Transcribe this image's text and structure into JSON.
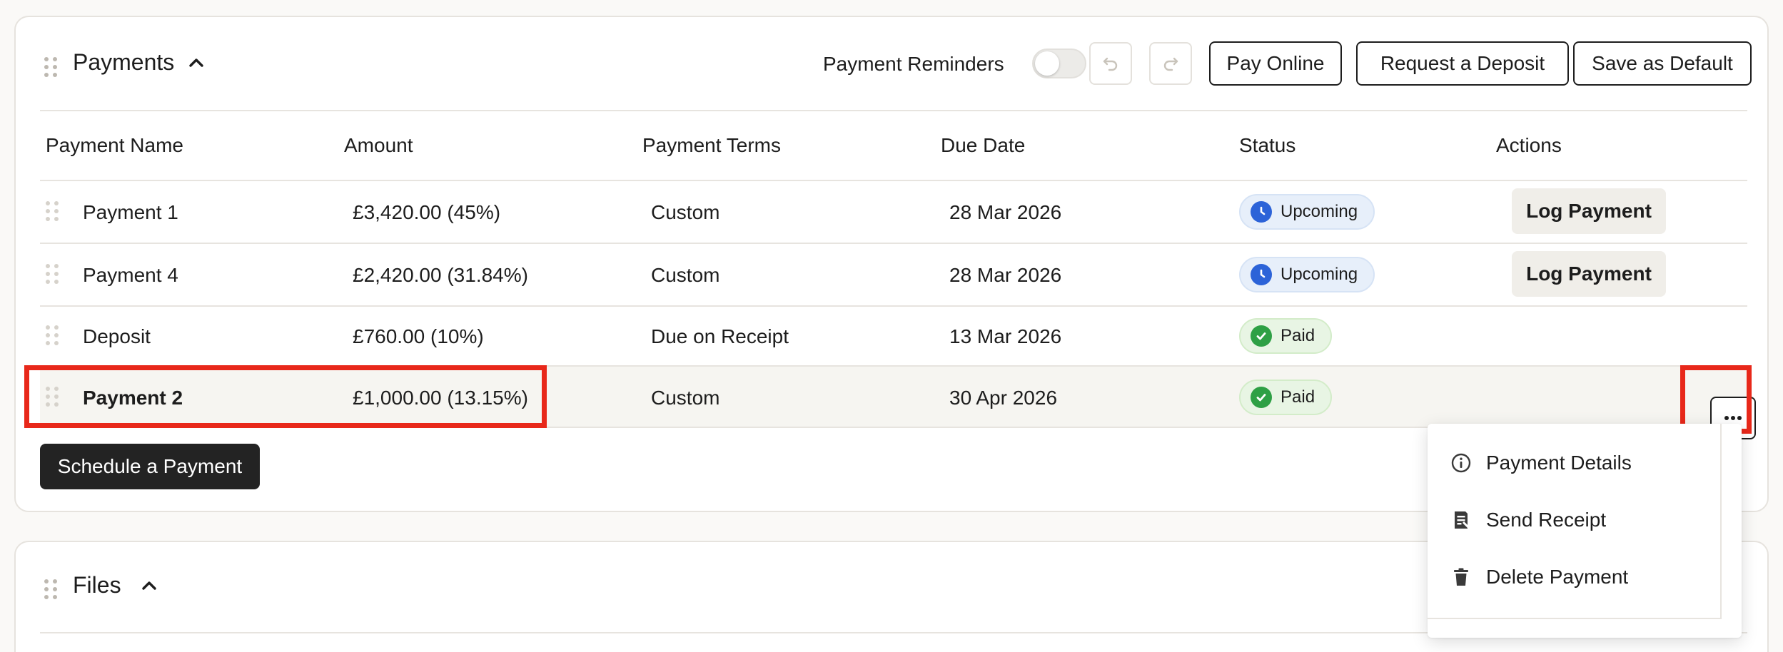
{
  "payments_section": {
    "title": "Payments",
    "reminders_label": "Payment Reminders",
    "reminders_on": false,
    "pay_online_label": "Pay Online",
    "request_deposit_label": "Request a Deposit",
    "save_default_label": "Save as Default",
    "schedule_label": "Schedule a Payment"
  },
  "table": {
    "headers": [
      "Payment Name",
      "Amount",
      "Payment Terms",
      "Due Date",
      "Status",
      "Actions"
    ],
    "rows": [
      {
        "name": "Payment 1",
        "amount": "£3,420.00 (45%)",
        "terms": "Custom",
        "due": "28 Mar 2026",
        "status": "Upcoming",
        "action": "Log Payment"
      },
      {
        "name": "Payment 4",
        "amount": "£2,420.00 (31.84%)",
        "terms": "Custom",
        "due": "28 Mar 2026",
        "status": "Upcoming",
        "action": "Log Payment"
      },
      {
        "name": "Deposit",
        "amount": "£760.00 (10%)",
        "terms": "Due on Receipt",
        "due": "13 Mar 2026",
        "status": "Paid",
        "action": ""
      },
      {
        "name": "Payment 2",
        "amount": "£1,000.00 (13.15%)",
        "terms": "Custom",
        "due": "30 Apr 2026",
        "status": "Paid",
        "action": ""
      }
    ]
  },
  "context_menu": {
    "items": [
      "Payment Details",
      "Send Receipt",
      "Delete Payment"
    ]
  },
  "files_section": {
    "title": "Files"
  },
  "colors": {
    "highlight": "#e8281a",
    "upcoming": "#2c63d8",
    "paid": "#2ea045"
  }
}
